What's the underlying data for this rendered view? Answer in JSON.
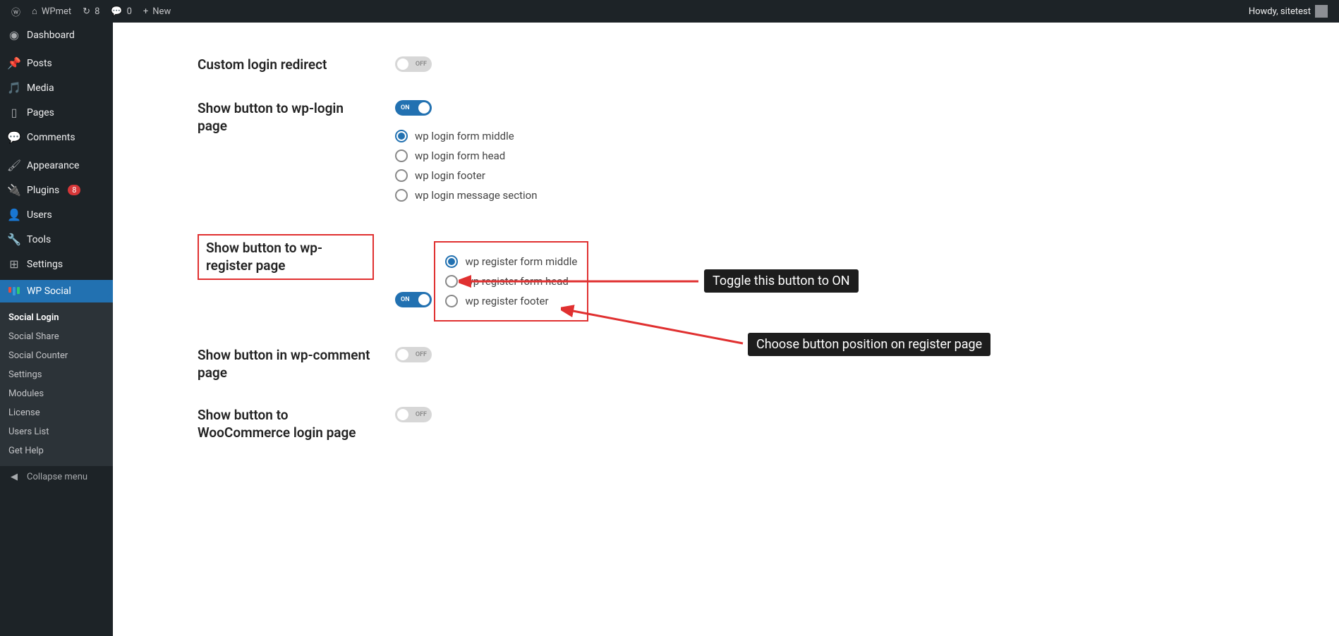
{
  "adminbar": {
    "site_name": "WPmet",
    "updates": "8",
    "comments": "0",
    "new": "New",
    "howdy": "Howdy, sitetest"
  },
  "sidebar": {
    "items": [
      {
        "icon": "dashboard",
        "label": "Dashboard"
      },
      {
        "icon": "pin",
        "label": "Posts"
      },
      {
        "icon": "media",
        "label": "Media"
      },
      {
        "icon": "page",
        "label": "Pages"
      },
      {
        "icon": "comment",
        "label": "Comments"
      },
      {
        "icon": "brush",
        "label": "Appearance"
      },
      {
        "icon": "plug",
        "label": "Plugins",
        "badge": "8"
      },
      {
        "icon": "user",
        "label": "Users"
      },
      {
        "icon": "wrench",
        "label": "Tools"
      },
      {
        "icon": "sliders",
        "label": "Settings"
      },
      {
        "icon": "wpsocial",
        "label": "WP Social"
      }
    ],
    "submenu": [
      {
        "label": "Social Login",
        "active": true
      },
      {
        "label": "Social Share"
      },
      {
        "label": "Social Counter"
      },
      {
        "label": "Settings"
      },
      {
        "label": "Modules"
      },
      {
        "label": "License"
      },
      {
        "label": "Users List"
      },
      {
        "label": "Get Help"
      }
    ],
    "collapse": "Collapse menu"
  },
  "settings": {
    "custom_login_redirect": {
      "label": "Custom login redirect",
      "state": "off"
    },
    "wp_login": {
      "label": "Show button to wp-login page",
      "state": "on",
      "options": [
        {
          "label": "wp login form middle",
          "selected": true
        },
        {
          "label": "wp login form head"
        },
        {
          "label": "wp login footer"
        },
        {
          "label": "wp login message section"
        }
      ]
    },
    "wp_register": {
      "label": "Show button to wp-register page",
      "state": "on",
      "options": [
        {
          "label": "wp register form middle",
          "selected": true
        },
        {
          "label": "wp register form head"
        },
        {
          "label": "wp register footer"
        }
      ]
    },
    "wp_comment": {
      "label": "Show button in wp-comment page",
      "state": "off"
    },
    "woocommerce": {
      "label": "Show button to WooCommerce login page",
      "state": "off"
    }
  },
  "annotations": {
    "toggle_on": "Toggle this button to ON",
    "choose_pos": "Choose button position on register page"
  },
  "toggle_text": {
    "on": "ON",
    "off": "OFF"
  }
}
